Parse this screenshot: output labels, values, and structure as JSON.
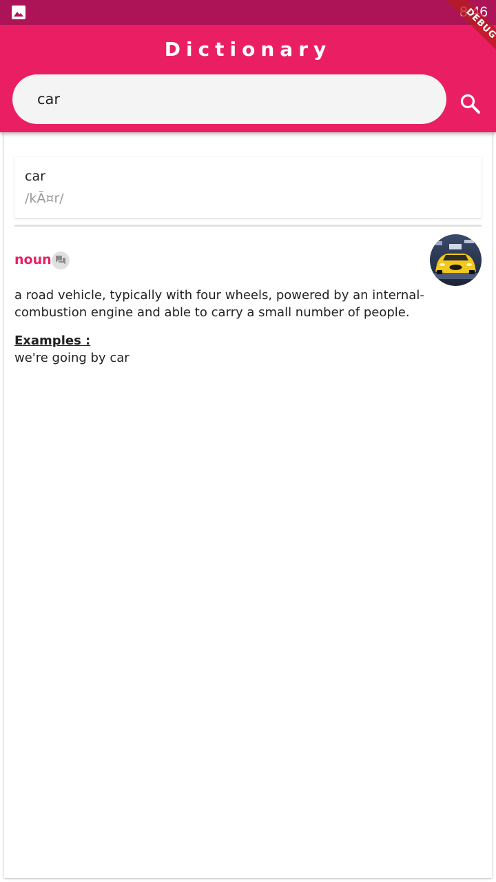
{
  "status_bar": {
    "time": "8:46",
    "image_icon": "image-icon",
    "color": "#ad1457"
  },
  "debug_banner": {
    "label": "DEBUG"
  },
  "app_bar": {
    "title": "Dictionary",
    "color": "#ea1f63"
  },
  "search": {
    "value": "car",
    "icon": "search-icon"
  },
  "result": {
    "word": "car",
    "phonetic": "/kÃ¤r/",
    "part_of_speech": "noun",
    "pos_color": "#e91e63",
    "speak_icon": "forum-icon",
    "image_icon": "car-thumbnail",
    "definition": "a road vehicle, typically with four wheels, powered by an internal-combustion engine and able to carry a small number of people.",
    "examples_label": "Examples :",
    "example": "we're going by car"
  }
}
